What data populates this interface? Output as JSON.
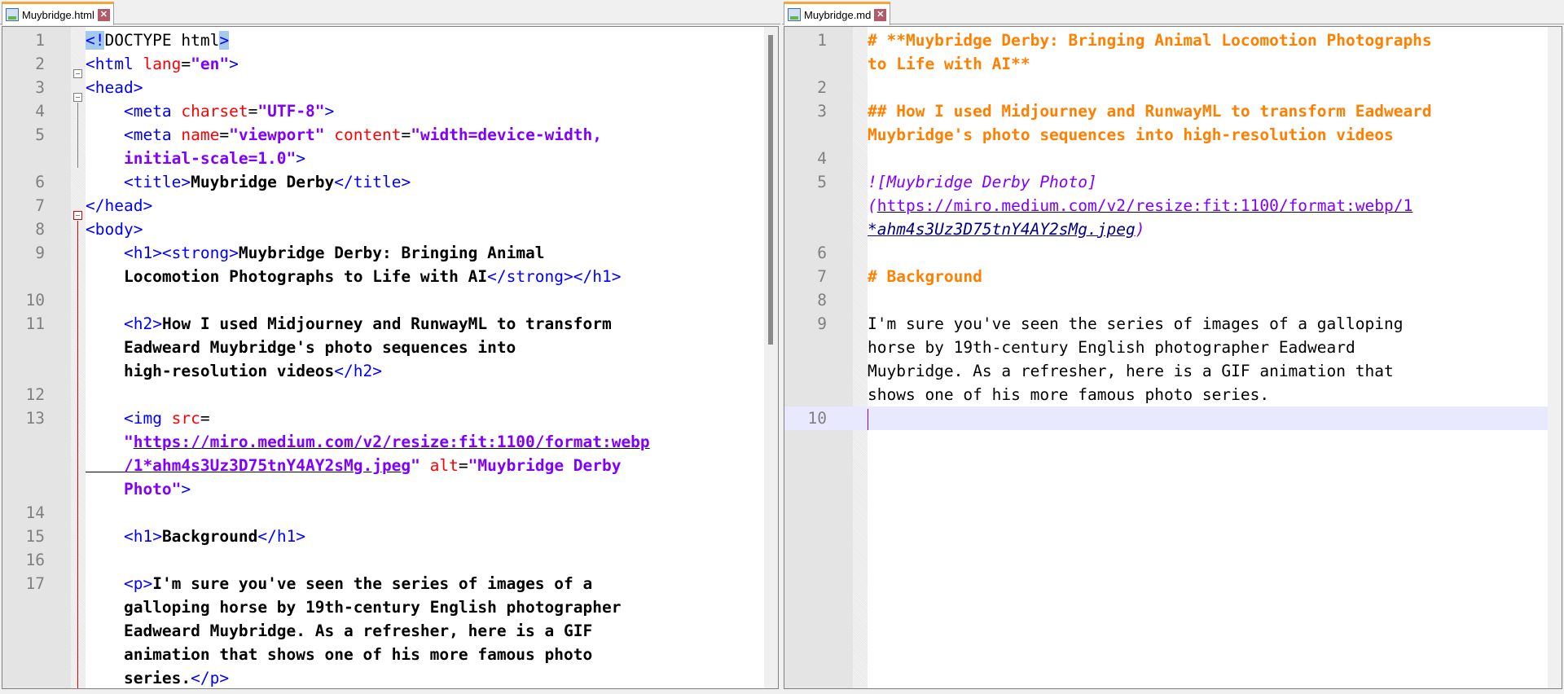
{
  "left": {
    "tab": "Muybridge.html",
    "rows": [
      {
        "n": "1",
        "s": [
          [
            "t sel",
            "<!"
          ],
          [
            "p",
            "DOCTYPE html"
          ],
          [
            "t sel",
            ">"
          ]
        ]
      },
      {
        "n": "2",
        "s": [
          [
            "t",
            "<html "
          ],
          [
            "a",
            "lang"
          ],
          [
            "p",
            "="
          ],
          [
            "v",
            "\"en\""
          ],
          [
            "t",
            ">"
          ]
        ]
      },
      {
        "n": "3",
        "s": [
          [
            "t",
            "<head>"
          ]
        ]
      },
      {
        "n": "4",
        "s": [
          [
            "p",
            "    "
          ],
          [
            "t",
            "<meta "
          ],
          [
            "a",
            "charset"
          ],
          [
            "p",
            "="
          ],
          [
            "v",
            "\"UTF-8\""
          ],
          [
            "t",
            ">"
          ]
        ]
      },
      {
        "n": "5",
        "s": [
          [
            "p",
            "    "
          ],
          [
            "t",
            "<meta "
          ],
          [
            "a",
            "name"
          ],
          [
            "p",
            "="
          ],
          [
            "v",
            "\"viewport\""
          ],
          [
            "p",
            " "
          ],
          [
            "a",
            "content"
          ],
          [
            "p",
            "="
          ],
          [
            "v",
            "\"width=device-width,"
          ]
        ]
      },
      {
        "n": "",
        "s": [
          [
            "v",
            "    initial-scale=1.0\""
          ],
          [
            "t",
            ">"
          ]
        ]
      },
      {
        "n": "6",
        "s": [
          [
            "p",
            "    "
          ],
          [
            "t",
            "<title>"
          ],
          [
            "x",
            "Muybridge Derby"
          ],
          [
            "t",
            "</title>"
          ]
        ]
      },
      {
        "n": "7",
        "s": [
          [
            "t",
            "</head>"
          ]
        ]
      },
      {
        "n": "8",
        "s": [
          [
            "t",
            "<body>"
          ]
        ]
      },
      {
        "n": "9",
        "s": [
          [
            "p",
            "    "
          ],
          [
            "t",
            "<h1><strong>"
          ],
          [
            "x",
            "Muybridge Derby: Bringing Animal"
          ]
        ]
      },
      {
        "n": "",
        "s": [
          [
            "x",
            "    Locomotion Photographs to Life with AI"
          ],
          [
            "t",
            "</strong></h1>"
          ]
        ]
      },
      {
        "n": "10",
        "s": []
      },
      {
        "n": "11",
        "s": [
          [
            "p",
            "    "
          ],
          [
            "t",
            "<h2>"
          ],
          [
            "x",
            "How I used Midjourney and RunwayML to transform"
          ]
        ]
      },
      {
        "n": "",
        "s": [
          [
            "x",
            "    Eadweard Muybridge's photo sequences into"
          ]
        ]
      },
      {
        "n": "",
        "s": [
          [
            "x",
            "    high-resolution videos"
          ],
          [
            "t",
            "</h2>"
          ]
        ]
      },
      {
        "n": "12",
        "s": []
      },
      {
        "n": "13",
        "s": [
          [
            "p",
            "    "
          ],
          [
            "t",
            "<img "
          ],
          [
            "a",
            "src"
          ],
          [
            "p",
            "="
          ]
        ]
      },
      {
        "n": "",
        "s": [
          [
            "v",
            "    \""
          ],
          [
            "u",
            "https://miro.medium.com/v2/resize:fit:1100/format:webp"
          ]
        ]
      },
      {
        "n": "",
        "s": [
          [
            "u",
            "    /1*ahm4s3Uz3D75tnY4AY2sMg.jpeg"
          ],
          [
            "v",
            "\""
          ],
          [
            "p",
            " "
          ],
          [
            "a",
            "alt"
          ],
          [
            "p",
            "="
          ],
          [
            "v",
            "\"Muybridge Derby"
          ]
        ]
      },
      {
        "n": "",
        "s": [
          [
            "v",
            "    Photo\""
          ],
          [
            "t",
            ">"
          ]
        ]
      },
      {
        "n": "14",
        "s": []
      },
      {
        "n": "15",
        "s": [
          [
            "p",
            "    "
          ],
          [
            "t",
            "<h1>"
          ],
          [
            "x",
            "Background"
          ],
          [
            "t",
            "</h1>"
          ]
        ]
      },
      {
        "n": "16",
        "s": []
      },
      {
        "n": "17",
        "s": [
          [
            "p",
            "    "
          ],
          [
            "t",
            "<p>"
          ],
          [
            "x",
            "I'm sure you've seen the series of images of a"
          ]
        ]
      },
      {
        "n": "",
        "s": [
          [
            "x",
            "    galloping horse by 19th-century English photographer"
          ]
        ]
      },
      {
        "n": "",
        "s": [
          [
            "x",
            "    Eadweard Muybridge. As a refresher, here is a GIF"
          ]
        ]
      },
      {
        "n": "",
        "s": [
          [
            "x",
            "    animation that shows one of his more famous photo"
          ]
        ]
      },
      {
        "n": "",
        "s": [
          [
            "x",
            "    series."
          ],
          [
            "t",
            "</p>"
          ]
        ]
      }
    ]
  },
  "right": {
    "tab": "Muybridge.md",
    "rows": [
      {
        "n": "1",
        "s": [
          [
            "h",
            "# **Muybridge Derby: Bringing Animal Locomotion Photographs"
          ]
        ]
      },
      {
        "n": "",
        "s": [
          [
            "h",
            "to Life with AI**"
          ]
        ]
      },
      {
        "n": "2",
        "s": []
      },
      {
        "n": "3",
        "s": [
          [
            "h",
            "## How I used Midjourney and RunwayML to transform Eadweard"
          ]
        ]
      },
      {
        "n": "",
        "s": [
          [
            "h",
            "Muybridge's photo sequences into high-resolution videos"
          ]
        ]
      },
      {
        "n": "4",
        "s": []
      },
      {
        "n": "5",
        "s": [
          [
            "i",
            "![Muybridge Derby Photo]"
          ]
        ]
      },
      {
        "n": "",
        "s": [
          [
            "i",
            "("
          ],
          [
            "l",
            "https://miro.medium.com/v2/resize:fit:1100/format:webp/1"
          ]
        ]
      },
      {
        "n": "",
        "s": [
          [
            "li",
            "*ahm4s3Uz3D75tnY4AY2sMg.jpeg"
          ],
          [
            "i",
            ")"
          ]
        ]
      },
      {
        "n": "6",
        "s": []
      },
      {
        "n": "7",
        "s": [
          [
            "h",
            "# Background"
          ]
        ]
      },
      {
        "n": "8",
        "s": []
      },
      {
        "n": "9",
        "s": [
          [
            "p",
            "I'm sure you've seen the series of images of a galloping"
          ]
        ]
      },
      {
        "n": "",
        "s": [
          [
            "p",
            "horse by 19th-century English photographer Eadweard"
          ]
        ]
      },
      {
        "n": "",
        "s": [
          [
            "p",
            "Muybridge. As a refresher, here is a GIF animation that"
          ]
        ]
      },
      {
        "n": "",
        "s": [
          [
            "p",
            "shows one of his more famous photo series."
          ]
        ]
      },
      {
        "n": "10",
        "s": [],
        "current": true
      }
    ]
  }
}
